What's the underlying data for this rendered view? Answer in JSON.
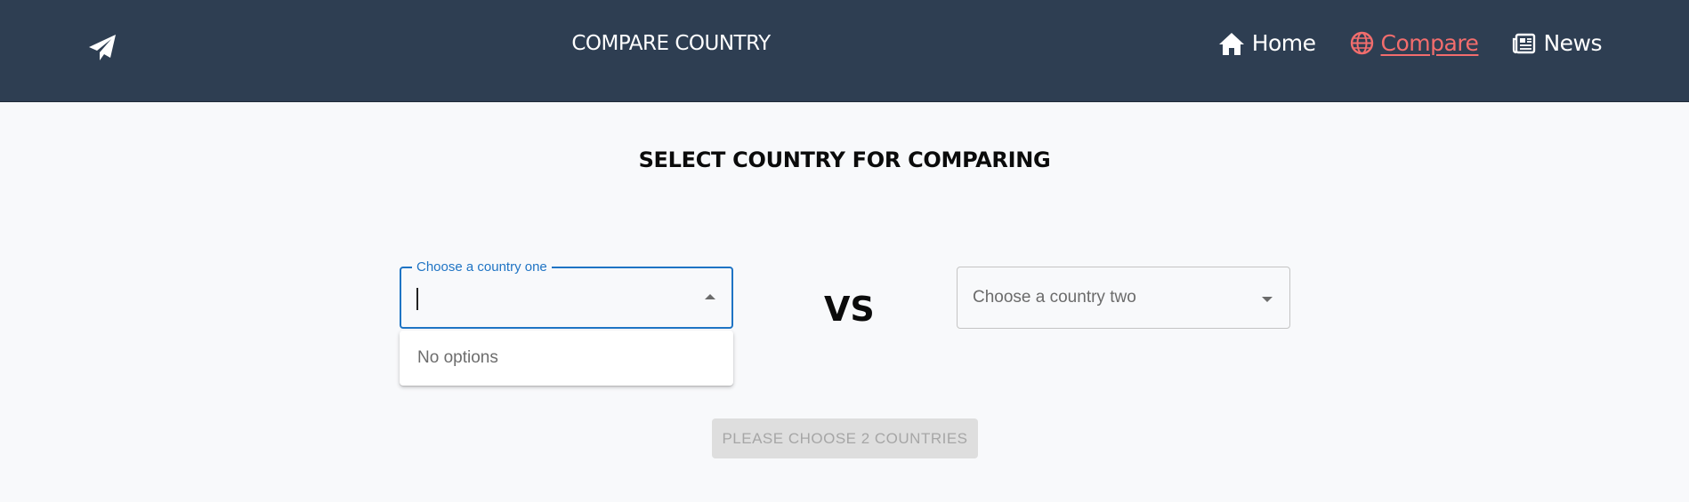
{
  "header": {
    "logo_icon": "paper-plane-icon",
    "title": "COMPARE COUNTRY",
    "nav": [
      {
        "label": "Home",
        "icon": "home-icon",
        "active": false
      },
      {
        "label": "Compare",
        "icon": "globe-icon",
        "active": true
      },
      {
        "label": "News",
        "icon": "newspaper-icon",
        "active": false
      }
    ]
  },
  "main": {
    "title": "SELECT COUNTRY FOR COMPARING",
    "country_one": {
      "label": "Choose a country one",
      "value": "",
      "no_options_text": "No options"
    },
    "vs_label": "VS",
    "country_two": {
      "placeholder": "Choose a country two"
    },
    "submit_label": "PLEASE CHOOSE 2 COUNTRIES"
  },
  "colors": {
    "header_bg": "#2e3e52",
    "accent": "#f26d6d",
    "focus": "#1f74c4",
    "page_bg": "#f8f9fb"
  }
}
